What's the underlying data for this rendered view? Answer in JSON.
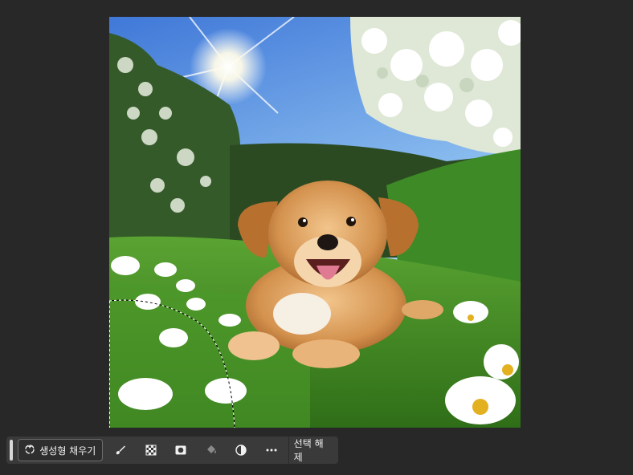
{
  "canvas": {
    "image_description_icon": "puppy-photo",
    "selection": "lasso-selection-bottom-left"
  },
  "taskbar": {
    "generative_fill_label": "생성형 채우기",
    "tools": [
      {
        "icon": "brush-icon"
      },
      {
        "icon": "transparency-checker-icon"
      },
      {
        "icon": "mask-icon"
      },
      {
        "icon": "paint-bucket-icon"
      },
      {
        "icon": "invert-contrast-icon"
      },
      {
        "icon": "more-options-icon"
      }
    ],
    "deselect_label": "선택 해제"
  },
  "colors": {
    "background": "#282828",
    "taskbar": "#3a3a3a",
    "text": "#f0f0f0"
  }
}
